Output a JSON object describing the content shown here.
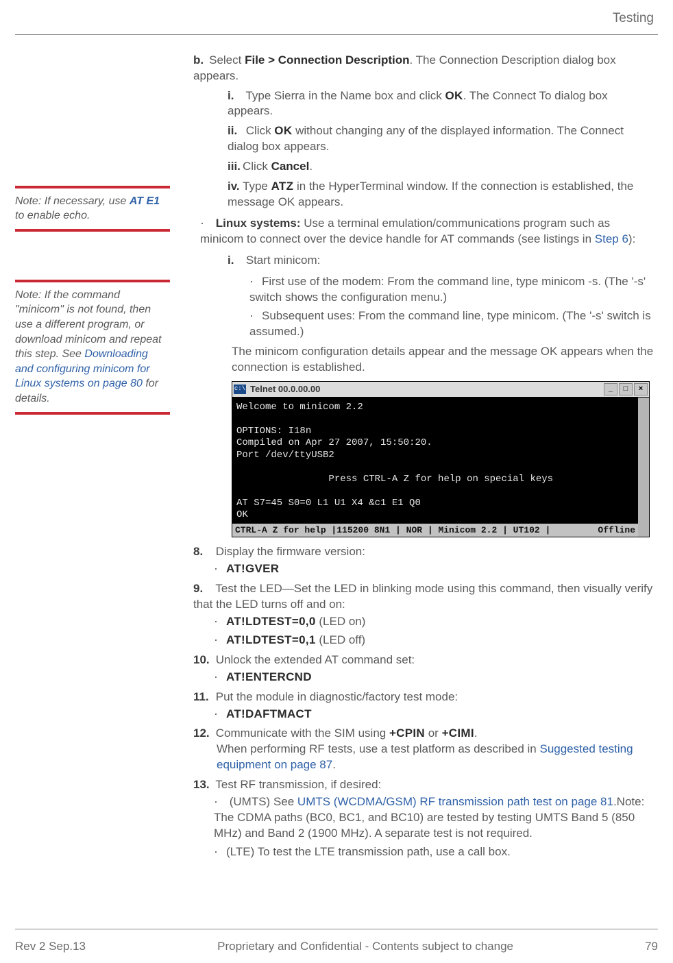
{
  "header": {
    "section": "Testing"
  },
  "sidenotes": {
    "echo": {
      "prefix": "Note:  If necessary, use ",
      "cmd": "AT E1",
      "suffix": " to enable echo."
    },
    "minicom": {
      "t1": "Note:  If the command \"minicom\" is not found, then use a different program, or download minicom and repeat this step. See ",
      "link": "Downloading and configuring minicom for Linux systems on page 80",
      "t2": " for details."
    }
  },
  "steps": {
    "b": {
      "marker": "b.",
      "text1": "Select ",
      "ui": "File > Connection Description",
      "text2": ". The Connection Description dialog box appears."
    },
    "roman": {
      "i": {
        "rm": "i.",
        "t": "Type Sierra in the Name box and click ",
        "ui": "OK",
        "t2": ". The Connect To dialog box appears."
      },
      "ii": {
        "rm": "ii.",
        "t": "Click ",
        "ui": "OK",
        "t2": " without changing any of the displayed information. The Connect dialog box appears."
      },
      "iii": {
        "rm": "iii.",
        "t": "Click ",
        "ui": "Cancel",
        "t2": "."
      },
      "iv": {
        "rm": "iv.",
        "t": "Type ",
        "ui": "ATZ",
        "t2": " in the HyperTerminal window. If the connection is established, the message OK appears."
      }
    },
    "linuxIntro": {
      "bold": "Linux systems:",
      "t": " Use a terminal emulation/communications program such as minicom to connect over the device handle for AT commands (see listings in ",
      "link": "Step 6",
      "t2": "):"
    },
    "linux_i": {
      "rm": "i.",
      "t": "Start minicom:"
    },
    "linux_first": "First use of the modem: From the command line, type minicom -s. (The '-s' switch shows the configuration menu.)",
    "linux_sub": "Subsequent uses: From the command line, type minicom. (The '-s' switch is assumed.)",
    "linux_after": "The minicom configuration details appear and the message OK appears when the connection is established.",
    "s8": {
      "n": "8.",
      "t": "Display the firmware version:",
      "cmd": "AT!GVER"
    },
    "s9": {
      "n": "9.",
      "t": "Test the LED—Set the LED in blinking mode using this command, then visually verify that the LED turns off and on:",
      "cmd1": "AT!LDTEST=0,0",
      "cmd1s": " (LED on)",
      "cmd2": "AT!LDTEST=0,1",
      "cmd2s": " (LED off)"
    },
    "s10": {
      "n": "10.",
      "t": "Unlock the extended AT command set:",
      "cmd": "AT!ENTERCND"
    },
    "s11": {
      "n": "11.",
      "t": "Put the module in diagnostic/factory test mode:",
      "cmd": "AT!DAFTMACT"
    },
    "s12": {
      "n": "12.",
      "t1": "Communicate with the SIM using ",
      "c1": "+CPIN",
      "mid": " or ",
      "c2": "+CIMI",
      "t2": ".",
      "t3": "When performing RF tests, use a test platform as described in ",
      "link": "Suggested testing equipment on page 87",
      "t4": "."
    },
    "s13": {
      "n": "13.",
      "t": "Test RF transmission, if desired:",
      "umts1": "(UMTS) See ",
      "umtslink": "UMTS (WCDMA/GSM) RF transmission path test on page 81",
      "umts2": ".Note: The CDMA paths (BC0, BC1, and BC10) are tested by testing UMTS Band 5 (850 MHz) and Band 2 (1900 MHz). A separate test is not required.",
      "lte": "(LTE) To test the LTE transmission path, use a call box."
    }
  },
  "terminal": {
    "title": "Telnet 00.0.00.00",
    "body": "Welcome to minicom 2.2\n\nOPTIONS: I18n\nCompiled on Apr 27 2007, 15:50:20.\nPort /dev/ttyUSB2\n\n                Press CTRL-A Z for help on special keys\n\nAT S7=45 S0=0 L1 U1 X4 &c1 E1 Q0\nOK",
    "status_left": " CTRL-A Z for help |115200 8N1 | NOR | Minicom 2.2 | UT102 |",
    "status_right": "Offline"
  },
  "footer": {
    "left": "Rev 2  Sep.13",
    "center": "Proprietary and Confidential - Contents subject to change",
    "right": "79"
  }
}
